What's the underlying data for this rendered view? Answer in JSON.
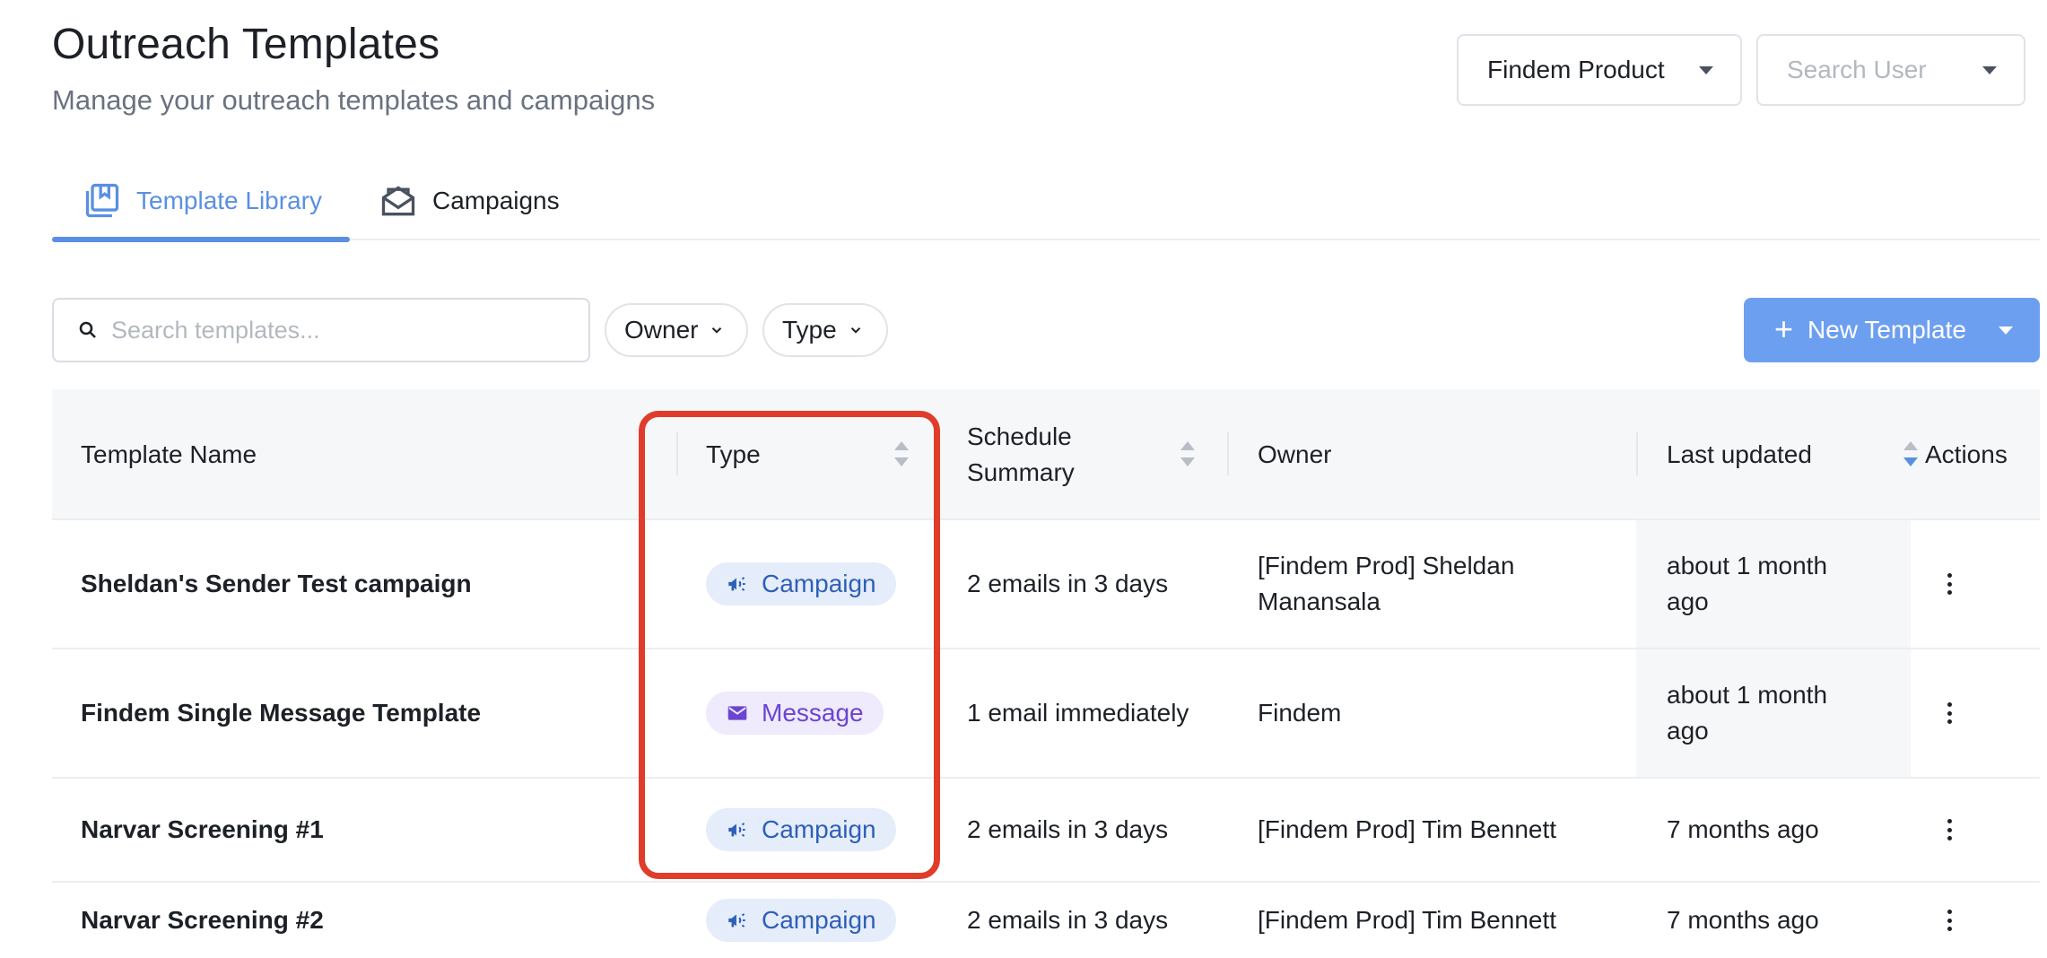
{
  "header": {
    "title": "Outreach Templates",
    "subtitle": "Manage your outreach templates and campaigns",
    "product_selector": "Findem Product",
    "user_search_placeholder": "Search User"
  },
  "tabs": [
    {
      "label": "Template Library",
      "active": true,
      "icon": "book-icon"
    },
    {
      "label": "Campaigns",
      "active": false,
      "icon": "envelope-open-icon"
    }
  ],
  "toolbar": {
    "search_placeholder": "Search templates...",
    "filter_owner": "Owner",
    "filter_type": "Type",
    "new_template": "New Template"
  },
  "table": {
    "columns": {
      "name": "Template Name",
      "type": "Type",
      "schedule": "Schedule Summary",
      "owner": "Owner",
      "updated": "Last updated",
      "actions": "Actions"
    },
    "rows": [
      {
        "name": "Sheldan's Sender Test campaign",
        "type": "Campaign",
        "schedule": "2 emails in 3 days",
        "owner": "[Findem Prod] Sheldan Manansala",
        "updated": "about 1 month ago"
      },
      {
        "name": "Findem Single Message Template",
        "type": "Message",
        "schedule": "1 email immediately",
        "owner": "Findem",
        "updated": "about 1 month ago"
      },
      {
        "name": "Narvar Screening #1",
        "type": "Campaign",
        "schedule": "2 emails in 3 days",
        "owner": "[Findem Prod] Tim Bennett",
        "updated": "7 months ago"
      },
      {
        "name": "Narvar Screening #2",
        "type": "Campaign",
        "schedule": "2 emails in 3 days",
        "owner": "[Findem Prod] Tim Bennett",
        "updated": "7 months ago"
      }
    ]
  },
  "colors": {
    "accent": "#5a8fe3",
    "button": "#6d9ff0",
    "campaign_badge_bg": "#e5edfb",
    "campaign_badge_text": "#2f5fb8",
    "message_badge_bg": "#efeafc",
    "message_badge_text": "#6b45d1",
    "highlight": "#e03c2a"
  }
}
